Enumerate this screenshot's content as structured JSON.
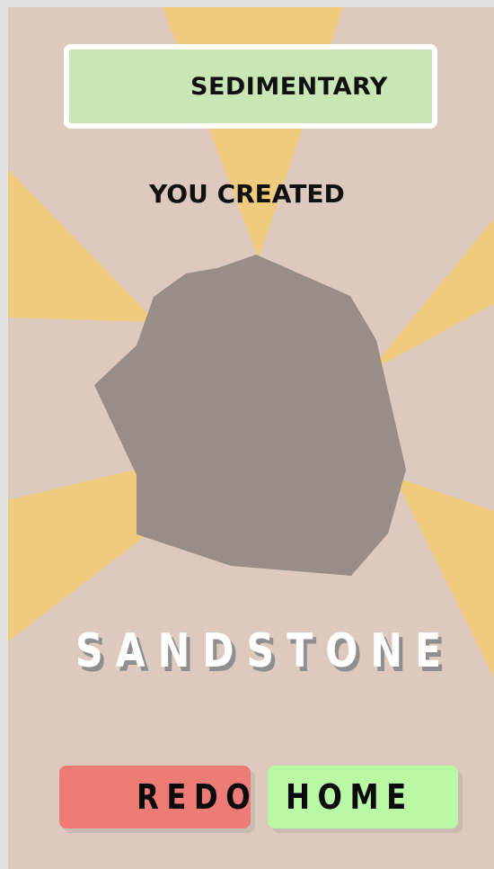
{
  "result": {
    "rock_type": "SEDIMENTARY",
    "intro": "YOU CREATED",
    "rock_name": "SANDSTONE"
  },
  "buttons": {
    "redo_label": "REDO",
    "home_label": "HOME"
  },
  "colors": {
    "background": "#ddc9bd",
    "sun_ray": "#f0cb7d",
    "rock": "#9a8d87",
    "type_box": "#c9e6b5",
    "redo_button": "#ed7c77",
    "home_button": "#b9f9a3"
  },
  "icons": {
    "rock": "rock-illustration",
    "rays": "sunburst-rays"
  }
}
